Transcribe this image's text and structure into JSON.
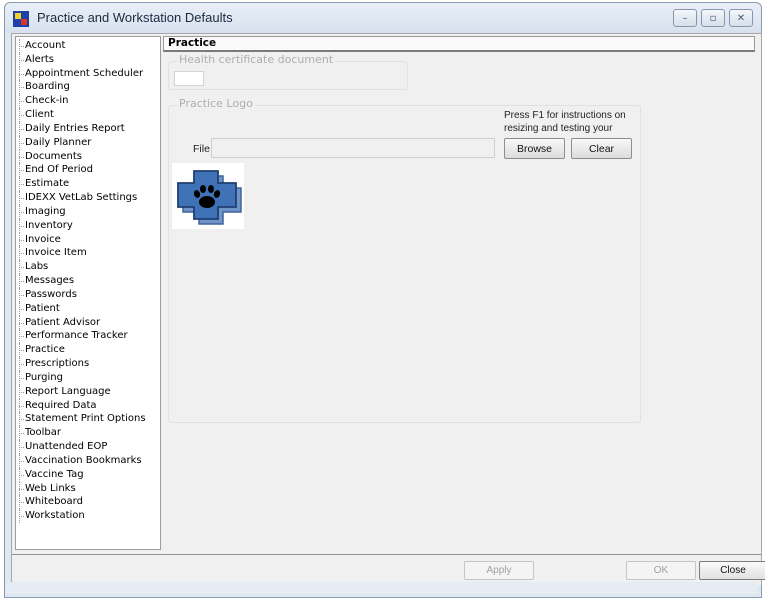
{
  "window": {
    "title": "Practice and Workstation Defaults",
    "controls": {
      "minimize": "–",
      "restore": "▫",
      "close": "✕"
    }
  },
  "sidebar": {
    "items": [
      "Account",
      "Alerts",
      "Appointment Scheduler",
      "Boarding",
      "Check-in",
      "Client",
      "Daily Entries Report",
      "Daily Planner",
      "Documents",
      "End Of Period",
      "Estimate",
      "IDEXX VetLab Settings",
      "Imaging",
      "Inventory",
      "Invoice",
      "Invoice Item",
      "Labs",
      "Messages",
      "Passwords",
      "Patient",
      "Patient Advisor",
      "Performance Tracker",
      "Practice",
      "Prescriptions",
      "Purging",
      "Report Language",
      "Required Data",
      "Statement Print Options",
      "Toolbar",
      "Unattended EOP",
      "Vaccination Bookmarks",
      "Vaccine Tag",
      "Web Links",
      "Whiteboard",
      "Workstation"
    ],
    "selected": "Practice"
  },
  "main": {
    "section_title": "Practice",
    "health_cert": {
      "label": "Health certificate document",
      "value": ""
    },
    "logo_group": {
      "label": "Practice Logo",
      "note": "Press F1 for instructions on resizing and testing your",
      "file_label": "File",
      "file_value": "",
      "browse_label": "Browse",
      "clear_label": "Clear",
      "logo_icon": "paw-cross-logo-icon"
    }
  },
  "footer": {
    "apply_label": "Apply",
    "ok_label": "OK",
    "close_label": "Close"
  },
  "colors": {
    "logo_blue": "#3f72b7",
    "logo_dark": "#1f3f72",
    "title_bar": "#dfe7f1"
  }
}
